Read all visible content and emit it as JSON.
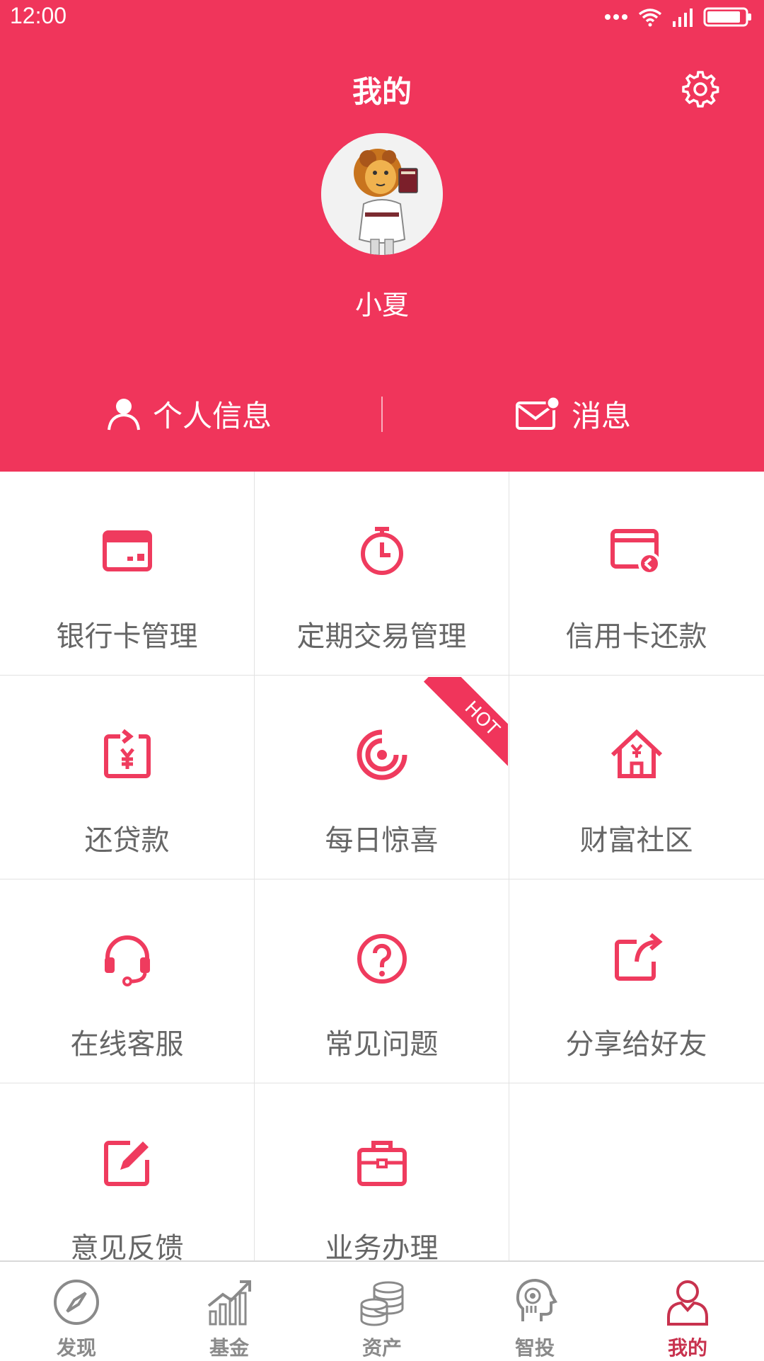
{
  "status_bar": {
    "time": "12:00"
  },
  "header": {
    "title": "我的",
    "username": "小夏",
    "accent_color": "#f0355b"
  },
  "actions": {
    "personal_info": "个人信息",
    "messages": "消息"
  },
  "grid": {
    "items": [
      {
        "label": "银行卡管理",
        "icon": "bank-card-icon"
      },
      {
        "label": "定期交易管理",
        "icon": "stopwatch-icon"
      },
      {
        "label": "信用卡还款",
        "icon": "credit-card-return-icon"
      },
      {
        "label": "还贷款",
        "icon": "loan-repay-icon"
      },
      {
        "label": "每日惊喜",
        "icon": "target-icon",
        "badge": "HOT"
      },
      {
        "label": "财富社区",
        "icon": "yuan-house-icon"
      },
      {
        "label": "在线客服",
        "icon": "headset-icon"
      },
      {
        "label": "常见问题",
        "icon": "question-icon"
      },
      {
        "label": "分享给好友",
        "icon": "share-icon"
      },
      {
        "label": "意见反馈",
        "icon": "edit-icon"
      },
      {
        "label": "业务办理",
        "icon": "briefcase-icon"
      }
    ]
  },
  "tabbar": {
    "tabs": [
      {
        "label": "发现",
        "icon": "compass-icon"
      },
      {
        "label": "基金",
        "icon": "chart-up-icon"
      },
      {
        "label": "资产",
        "icon": "coins-icon"
      },
      {
        "label": "智投",
        "icon": "robot-head-icon"
      },
      {
        "label": "我的",
        "icon": "user-icon",
        "active": true
      }
    ],
    "active_color": "#c8324e",
    "inactive_color": "#8a8a8a"
  }
}
